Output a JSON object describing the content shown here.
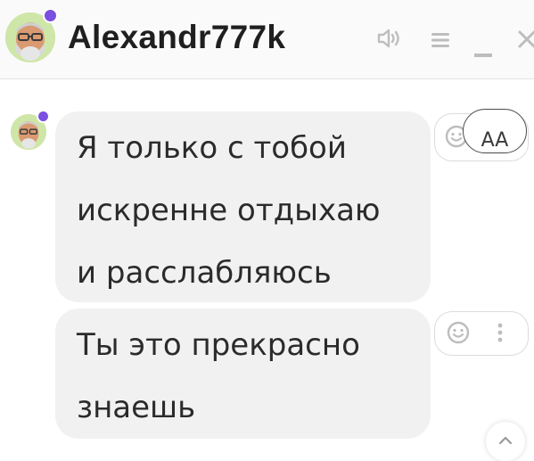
{
  "header": {
    "username": "Alexandr777k",
    "icons": {
      "avatar": "user-avatar",
      "status": "status-dot-icon",
      "sound": "speaker-icon",
      "menu": "hamburger-menu-icon",
      "minimize": "minimize-icon",
      "close": "close-icon"
    }
  },
  "messages": [
    {
      "lines": [
        "Я только с тобой",
        "искренне отдыхаю",
        "и расслабляюсь"
      ]
    },
    {
      "lines": [
        "Ты это прекрасно",
        "знаешь"
      ]
    }
  ],
  "controls": {
    "font_size_label": "AA",
    "emoji_icon": "smiley-icon",
    "more_icon": "vertical-dots-icon",
    "scroll_icon": "chevron-up-icon"
  },
  "colors": {
    "status_dot": "#7b4fe0",
    "bubble_bg": "#f1f1f1",
    "header_bg": "#fafafa",
    "icon_gray": "#bdbdbd"
  }
}
